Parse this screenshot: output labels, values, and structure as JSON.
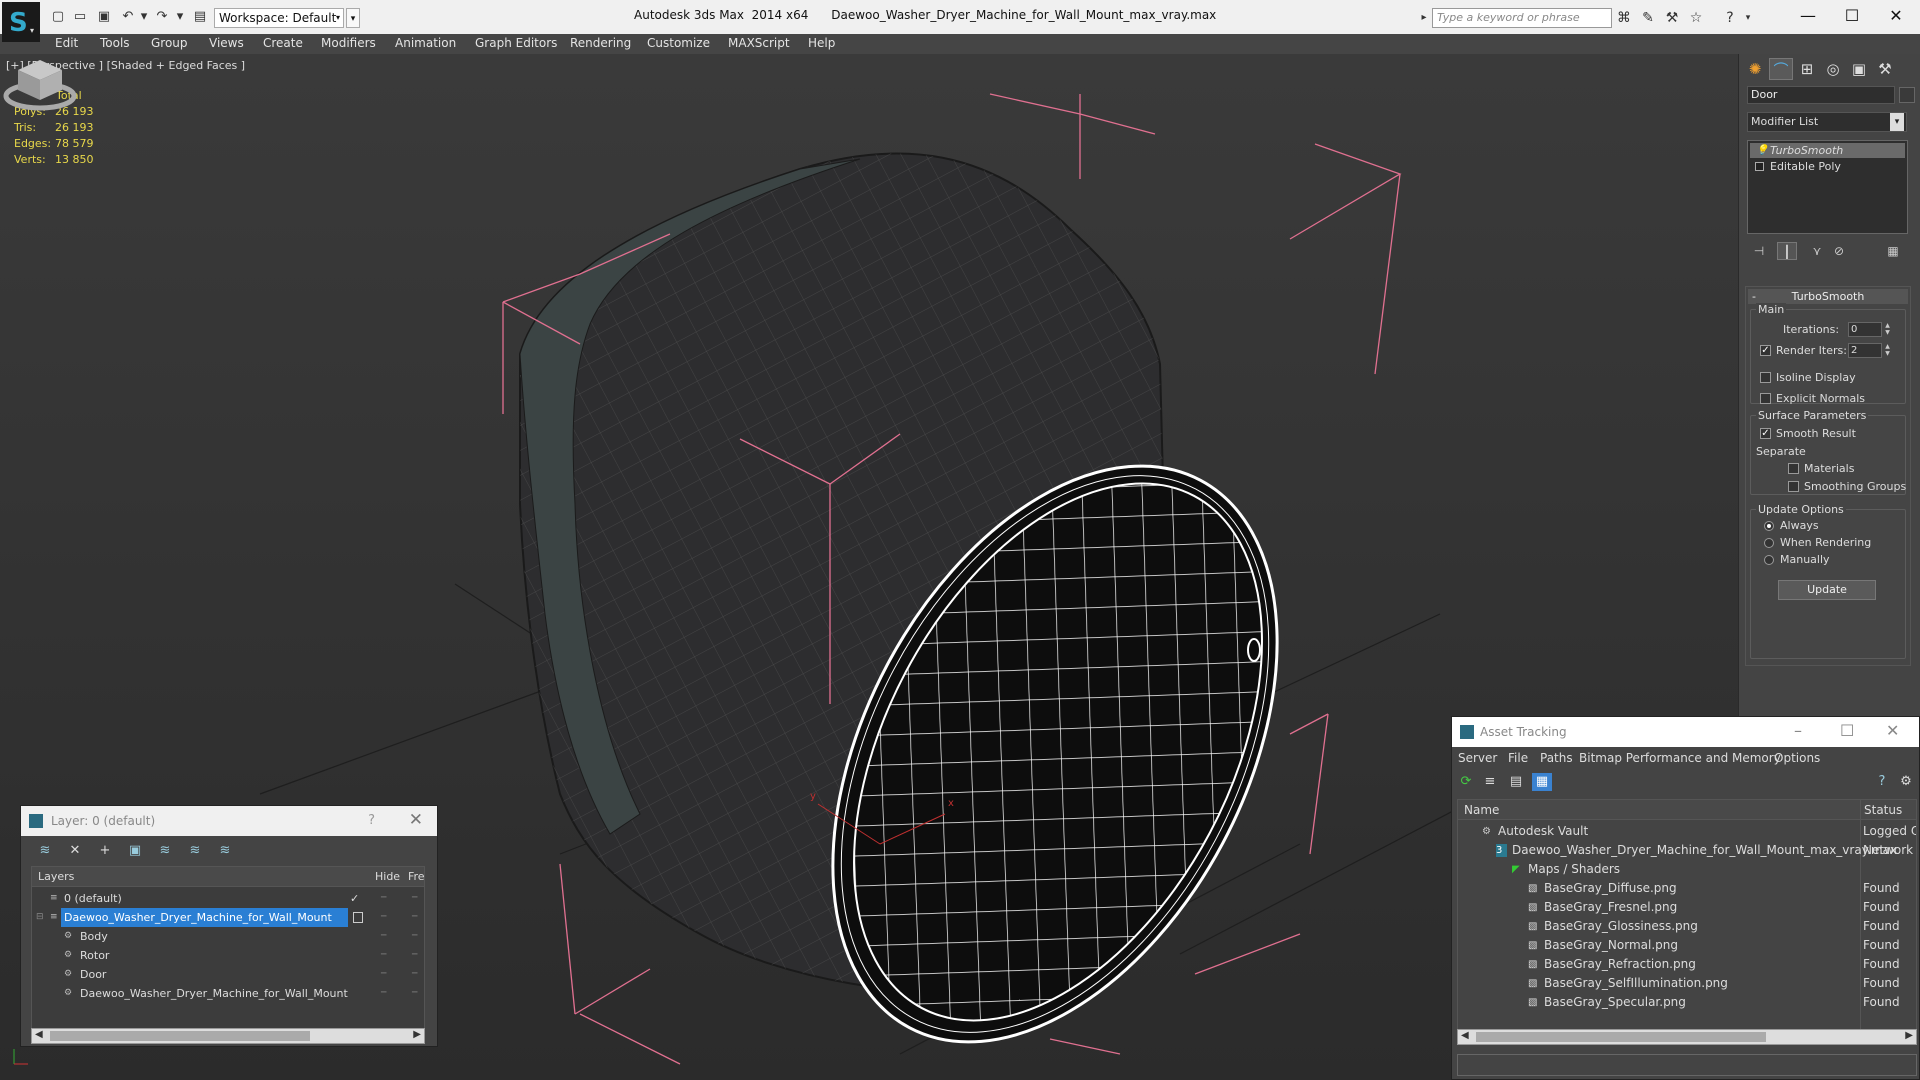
{
  "titlebar": {
    "workspace": "Workspace: Default",
    "app_name": "Autodesk 3ds Max  2014 x64",
    "file_name": "Daewoo_Washer_Dryer_Machine_for_Wall_Mount_max_vray.max",
    "search_placeholder": "Type a keyword or phrase"
  },
  "menu": [
    "Edit",
    "Tools",
    "Group",
    "Views",
    "Create",
    "Modifiers",
    "Animation",
    "Graph Editors",
    "Rendering",
    "Customize",
    "MAXScript",
    "Help"
  ],
  "viewport": {
    "label": "[+] [Perspective ] [Shaded + Edged Faces ]",
    "stats": {
      "header": "Total",
      "rows": [
        {
          "label": "Polys:",
          "value": "26 193"
        },
        {
          "label": "Tris:",
          "value": "26 193"
        },
        {
          "label": "Edges:",
          "value": "78 579"
        },
        {
          "label": "Verts:",
          "value": "13 850"
        }
      ]
    }
  },
  "command_panel": {
    "object_name": "Door",
    "modifier_list": "Modifier List",
    "stack": [
      "TurboSmooth",
      "Editable Poly"
    ],
    "rollout": {
      "title": "TurboSmooth",
      "main_label": "Main",
      "iterations_label": "Iterations:",
      "iterations_value": "0",
      "render_iters_label": "Render Iters:",
      "render_iters_value": "2",
      "render_iters_checked": true,
      "isoline_label": "Isoline Display",
      "explicit_normals_label": "Explicit Normals",
      "surface_params_label": "Surface Parameters",
      "smooth_result_label": "Smooth Result",
      "separate_label": "Separate",
      "materials_label": "Materials",
      "smoothing_groups_label": "Smoothing Groups",
      "update_options_label": "Update Options",
      "always_label": "Always",
      "when_rendering_label": "When Rendering",
      "manually_label": "Manually",
      "update_button": "Update"
    }
  },
  "layer_dialog": {
    "title": "Layer: 0 (default)",
    "help": "?",
    "columns": {
      "layers": "Layers",
      "hide": "Hide",
      "freeze": "Fre"
    },
    "rows": [
      {
        "name": "0 (default)",
        "check": "✓"
      },
      {
        "name": "Daewoo_Washer_Dryer_Machine_for_Wall_Mount"
      },
      {
        "name": "Body"
      },
      {
        "name": "Rotor"
      },
      {
        "name": "Door"
      },
      {
        "name": "Daewoo_Washer_Dryer_Machine_for_Wall_Mount"
      }
    ]
  },
  "asset_dialog": {
    "title": "Asset Tracking",
    "menu": [
      "Server",
      "File",
      "Paths",
      "Bitmap Performance and Memory",
      "Options"
    ],
    "columns": {
      "name": "Name",
      "status": "Status"
    },
    "rows": [
      {
        "name": "Autodesk Vault",
        "status": "Logged O"
      },
      {
        "name": "Daewoo_Washer_Dryer_Machine_for_Wall_Mount_max_vray.max",
        "status": "Network P"
      },
      {
        "name": "Maps / Shaders",
        "status": ""
      },
      {
        "name": "BaseGray_Diffuse.png",
        "status": "Found"
      },
      {
        "name": "BaseGray_Fresnel.png",
        "status": "Found"
      },
      {
        "name": "BaseGray_Glossiness.png",
        "status": "Found"
      },
      {
        "name": "BaseGray_Normal.png",
        "status": "Found"
      },
      {
        "name": "BaseGray_Refraction.png",
        "status": "Found"
      },
      {
        "name": "BaseGray_SelfIllumination.png",
        "status": "Found"
      },
      {
        "name": "BaseGray_Specular.png",
        "status": "Found"
      }
    ]
  },
  "colors": {
    "accent": "#2a7fd4",
    "stats_yellow": "#e8d84a",
    "bbox_pink": "#e07090",
    "wire_white": "#ffffff"
  }
}
